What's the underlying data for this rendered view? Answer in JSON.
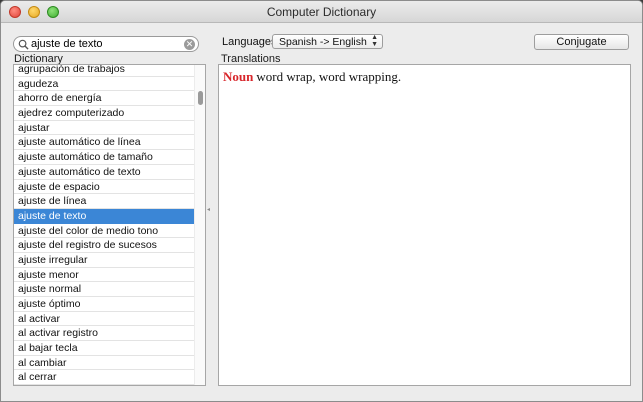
{
  "window": {
    "title": "Computer Dictionary"
  },
  "search": {
    "value": "ajuste de texto",
    "clear_glyph": "✕"
  },
  "dictionary": {
    "label": "Dictionary",
    "items": [
      "agrupación de trabajos",
      "agudeza",
      "ahorro de energía",
      "ajedrez computerizado",
      "ajustar",
      "ajuste automático de línea",
      "ajuste automático de tamaño",
      "ajuste automático de texto",
      "ajuste de espacio",
      "ajuste de línea",
      "ajuste de texto",
      "ajuste del color de medio tono",
      "ajuste del registro de sucesos",
      "ajuste irregular",
      "ajuste menor",
      "ajuste normal",
      "ajuste óptimo",
      "al activar",
      "al activar registro",
      "al bajar tecla",
      "al cambiar",
      "al cerrar"
    ],
    "selected_index": 10
  },
  "languages": {
    "label": "Languages:",
    "selected": "Spanish -> English"
  },
  "conjugate": {
    "label": "Conjugate"
  },
  "translations": {
    "label": "Translations",
    "part_of_speech": "Noun",
    "text": "word wrap, word wrapping."
  },
  "colors": {
    "selection": "#3b86d6",
    "part_of_speech": "#d8262b"
  }
}
